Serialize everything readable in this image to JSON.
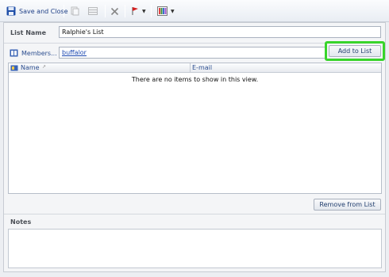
{
  "toolbar": {
    "save_close_label": "Save and Close",
    "icons": [
      "save-icon",
      "new-icon",
      "grid-icon",
      "delete-icon",
      "flag-icon",
      "categories-icon"
    ]
  },
  "list_name": {
    "label": "List Name",
    "value": "Ralphie's List"
  },
  "members": {
    "button_label": "Members...",
    "value": "buffalor",
    "add_button": "Add to List"
  },
  "grid": {
    "columns": [
      "Name",
      "E-mail"
    ],
    "empty_message": "There are no items to show in this view."
  },
  "remove_button": "Remove from List",
  "notes": {
    "label": "Notes",
    "value": ""
  },
  "colors": {
    "highlight": "#38d42b",
    "link": "#1a47b0",
    "save_icon": "#1f4ea8",
    "delete_icon": "#888888",
    "flag_icon": "#d42020"
  }
}
